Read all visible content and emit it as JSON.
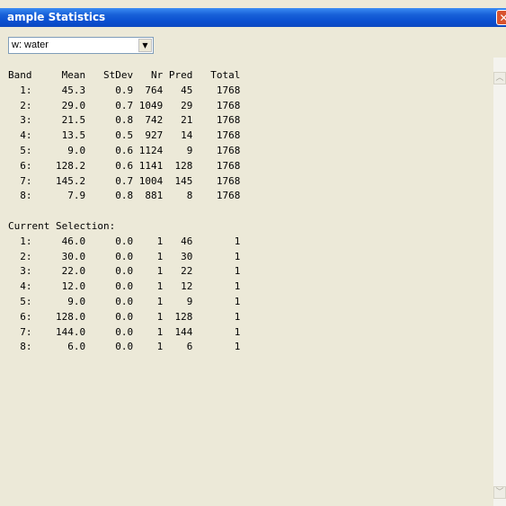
{
  "window": {
    "title": "ample Statistics",
    "close_icon": "close-icon"
  },
  "class_select": {
    "value": "w: water"
  },
  "stats_table": {
    "columns": [
      "Band",
      "Mean",
      "StDev",
      "Nr",
      "Pred",
      "Total"
    ],
    "rows": [
      {
        "band": "1:",
        "mean": "45.3",
        "stdev": "0.9",
        "nr": "764",
        "pred": "45",
        "total": "1768"
      },
      {
        "band": "2:",
        "mean": "29.0",
        "stdev": "0.7",
        "nr": "1049",
        "pred": "29",
        "total": "1768"
      },
      {
        "band": "3:",
        "mean": "21.5",
        "stdev": "0.8",
        "nr": "742",
        "pred": "21",
        "total": "1768"
      },
      {
        "band": "4:",
        "mean": "13.5",
        "stdev": "0.5",
        "nr": "927",
        "pred": "14",
        "total": "1768"
      },
      {
        "band": "5:",
        "mean": "9.0",
        "stdev": "0.6",
        "nr": "1124",
        "pred": "9",
        "total": "1768"
      },
      {
        "band": "6:",
        "mean": "128.2",
        "stdev": "0.6",
        "nr": "1141",
        "pred": "128",
        "total": "1768"
      },
      {
        "band": "7:",
        "mean": "145.2",
        "stdev": "0.7",
        "nr": "1004",
        "pred": "145",
        "total": "1768"
      },
      {
        "band": "8:",
        "mean": "7.9",
        "stdev": "0.8",
        "nr": "881",
        "pred": "8",
        "total": "1768"
      }
    ]
  },
  "current_selection": {
    "heading": "Current Selection:",
    "rows": [
      {
        "band": "1:",
        "mean": "46.0",
        "stdev": "0.0",
        "nr": "1",
        "pred": "46",
        "total": "1"
      },
      {
        "band": "2:",
        "mean": "30.0",
        "stdev": "0.0",
        "nr": "1",
        "pred": "30",
        "total": "1"
      },
      {
        "band": "3:",
        "mean": "22.0",
        "stdev": "0.0",
        "nr": "1",
        "pred": "22",
        "total": "1"
      },
      {
        "band": "4:",
        "mean": "12.0",
        "stdev": "0.0",
        "nr": "1",
        "pred": "12",
        "total": "1"
      },
      {
        "band": "5:",
        "mean": "9.0",
        "stdev": "0.0",
        "nr": "1",
        "pred": "9",
        "total": "1"
      },
      {
        "band": "6:",
        "mean": "128.0",
        "stdev": "0.0",
        "nr": "1",
        "pred": "128",
        "total": "1"
      },
      {
        "band": "7:",
        "mean": "144.0",
        "stdev": "0.0",
        "nr": "1",
        "pred": "144",
        "total": "1"
      },
      {
        "band": "8:",
        "mean": "6.0",
        "stdev": "0.0",
        "nr": "1",
        "pred": "6",
        "total": "1"
      }
    ]
  },
  "colors": {
    "titlebar": "#0a4fd0",
    "window_bg": "#ece9d8",
    "close_button": "#d8532e"
  },
  "icons": {
    "dropdown": "chevron-down-icon",
    "scroll_up": "scroll-up-arrow-icon",
    "scroll_down": "scroll-down-arrow-icon"
  }
}
